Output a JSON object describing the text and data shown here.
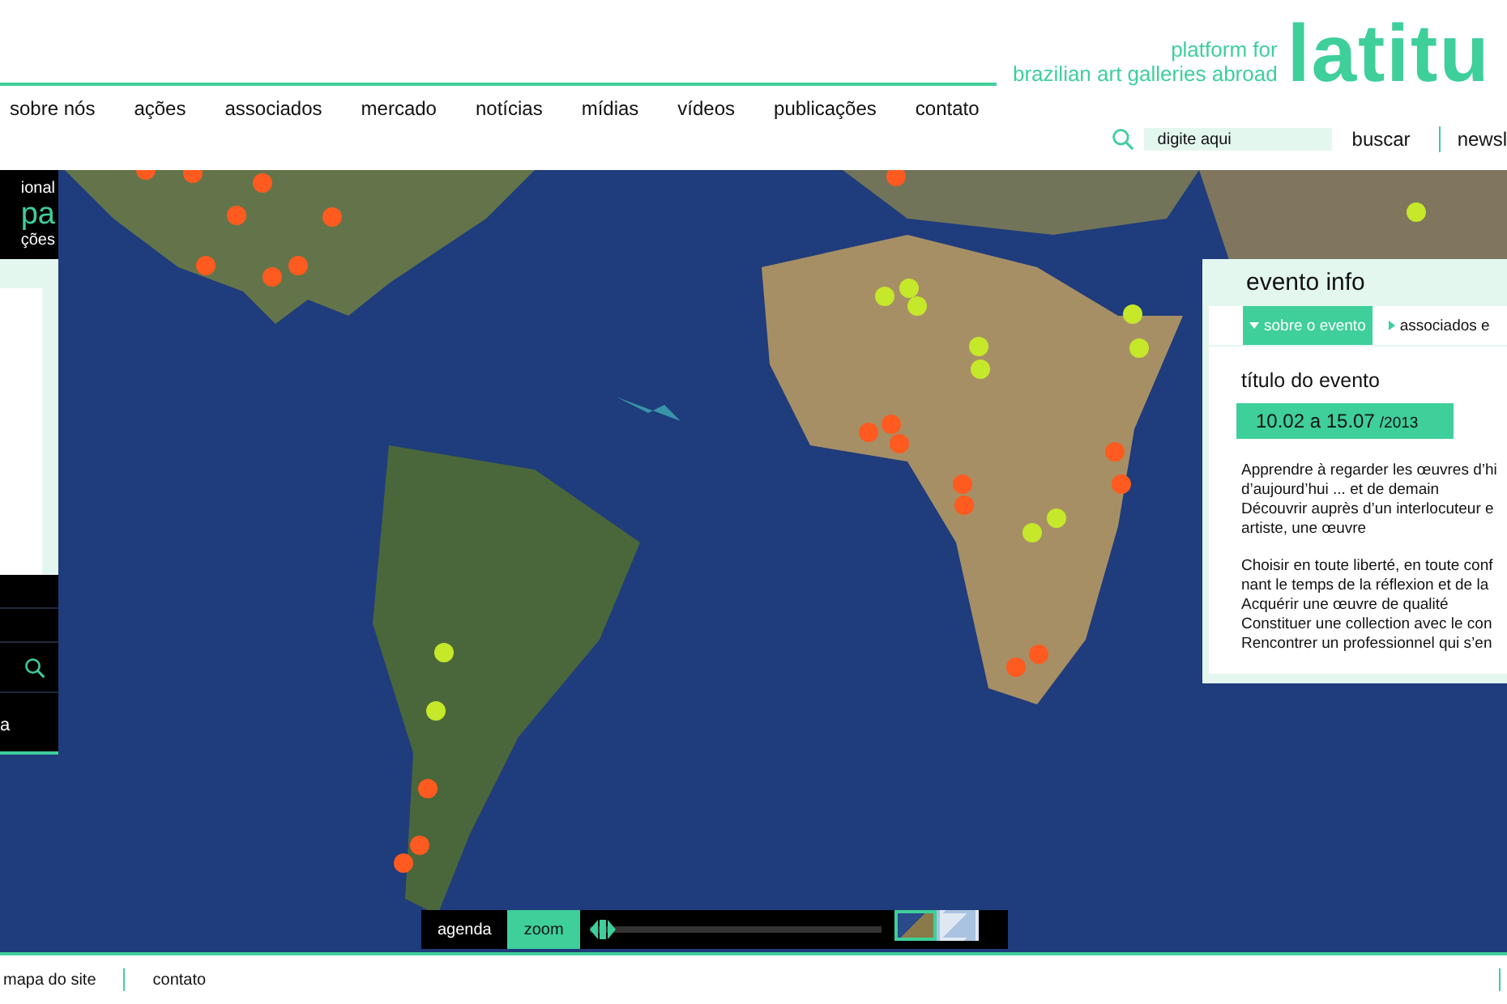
{
  "header": {
    "tagline": [
      "platform for",
      "brazilian art galleries abroad"
    ],
    "logo": "latitu",
    "nav": [
      "sobre nós",
      "ações",
      "associados",
      "mercado",
      "notícias",
      "mídias",
      "vídeos",
      "publicações",
      "contato"
    ],
    "search": {
      "placeholder": "digite aqui",
      "button": "buscar"
    },
    "extra_link": "newsl"
  },
  "side_panel": {
    "title_lines": [
      "ional",
      "pa",
      "ções"
    ],
    "bottom_text": "a"
  },
  "map": {
    "pins": [
      {
        "color": "#ff5a1f"
      },
      {
        "color": "#ff5a1f"
      },
      {
        "color": "#ff5a1f"
      },
      {
        "color": "#ff5a1f"
      },
      {
        "color": "#ff5a1f"
      },
      {
        "color": "#ff5a1f"
      },
      {
        "color": "#ff5a1f"
      },
      {
        "color": "#ff5a1f"
      },
      {
        "color": "#ff5a1f"
      },
      {
        "color": "#ff5a1f"
      },
      {
        "color": "#ff5a1f"
      },
      {
        "color": "#ff5a1f"
      },
      {
        "color": "#ff5a1f"
      },
      {
        "color": "#ff5a1f"
      },
      {
        "color": "#ff5a1f"
      },
      {
        "color": "#ff5a1f"
      },
      {
        "color": "#ff5a1f"
      },
      {
        "color": "#ff5a1f"
      },
      {
        "color": "#ff5a1f"
      },
      {
        "color": "#ff5a1f"
      },
      {
        "color": "#ff5a1f"
      },
      {
        "color": "#c5e82a"
      },
      {
        "color": "#c5e82a"
      },
      {
        "color": "#c5e82a"
      },
      {
        "color": "#c5e82a"
      },
      {
        "color": "#c5e82a"
      },
      {
        "color": "#c5e82a"
      },
      {
        "color": "#c5e82a"
      },
      {
        "color": "#c5e82a"
      },
      {
        "color": "#c5e82a"
      },
      {
        "color": "#c5e82a"
      },
      {
        "color": "#c5e82a"
      },
      {
        "color": "#c5e82a"
      }
    ]
  },
  "event_panel": {
    "title": "evento info",
    "tabs": [
      {
        "label": "sobre o evento",
        "selected": true
      },
      {
        "label": "associados e",
        "selected": false
      }
    ],
    "event_title": "título do evento",
    "dates": "10.02 a 15.07",
    "year": "/2013",
    "paragraphs": [
      [
        "Apprendre à regarder les œuvres d’hi",
        "d’aujourd’hui ... et de demain",
        "Découvrir auprès d’un interlocuteur e",
        "artiste, une œuvre"
      ],
      [
        "Choisir en toute liberté, en toute conf",
        "nant le temps de la réflexion et de la",
        "Acquérir une œuvre de qualité",
        "Constituer une collection avec le con",
        "Rencontrer un professionnel qui s’en"
      ]
    ]
  },
  "map_controls": {
    "modes": [
      {
        "label": "agenda",
        "selected": false
      },
      {
        "label": "zoom",
        "selected": true
      }
    ],
    "zoom_slider": {
      "level": 0.0
    },
    "map_types": [
      {
        "kind": "satellite",
        "selected": true
      },
      {
        "kind": "plain",
        "selected": false
      }
    ]
  },
  "footer": {
    "links": [
      "mapa do site",
      "contato"
    ]
  }
}
